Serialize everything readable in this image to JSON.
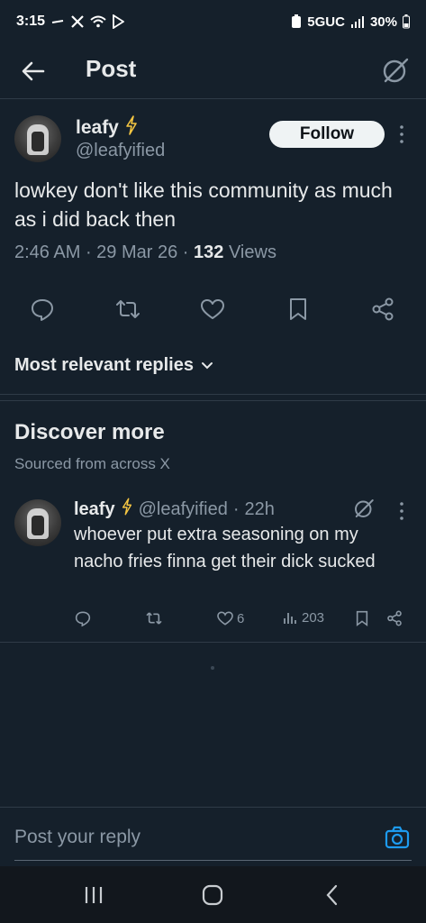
{
  "status_bar": {
    "time": "3:15",
    "network": "5GUC",
    "battery": "30%"
  },
  "header": {
    "title": "Post"
  },
  "post": {
    "author_name": "leafy",
    "author_handle": "@leafyified",
    "follow_label": "Follow",
    "text": "lowkey don't like this community as much as i did back then",
    "time": "2:46 AM",
    "date": "29 Mar 26",
    "views_count": "132",
    "views_label": "Views"
  },
  "replies": {
    "sort_label": "Most relevant replies"
  },
  "discover": {
    "title": "Discover more",
    "subtitle": "Sourced from across X"
  },
  "related_post": {
    "author_name": "leafy",
    "author_handle": "@leafyified",
    "age": "22h",
    "text": "whoever put extra seasoning on my nacho fries finna get their dick sucked",
    "likes": "6",
    "views": "203"
  },
  "composer": {
    "placeholder": "Post your reply"
  },
  "colors": {
    "background": "#15202b",
    "verified_bolt": "#f4c542",
    "accent": "#1d9bf0",
    "muted": "#8b98a5"
  }
}
